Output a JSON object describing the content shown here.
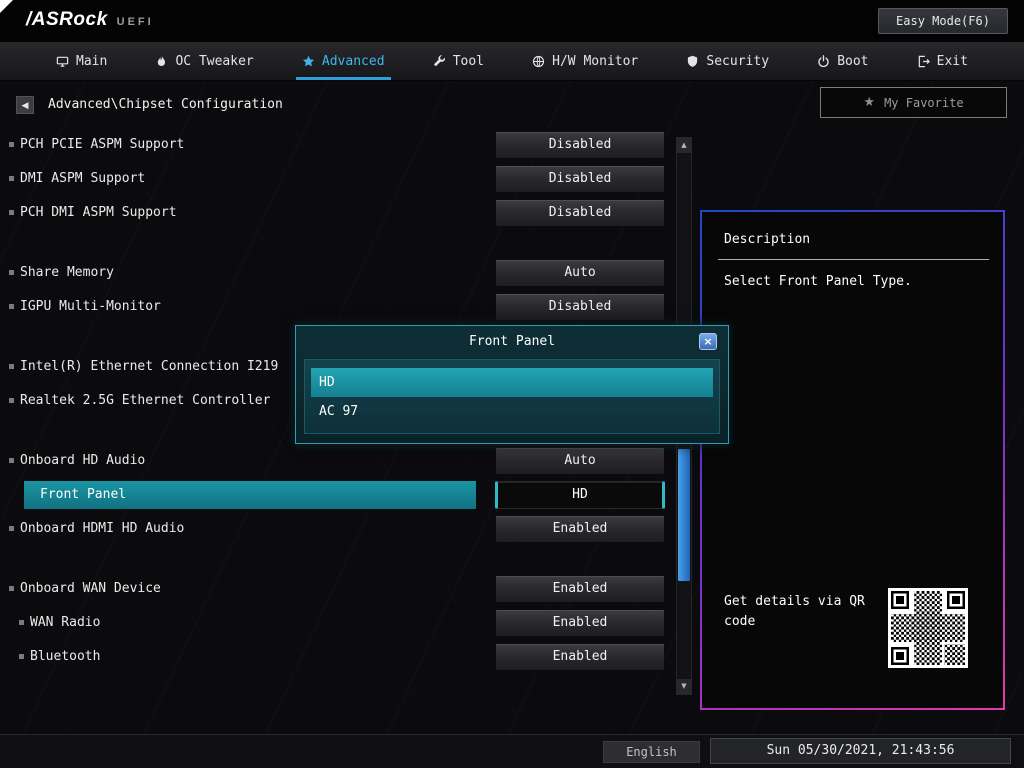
{
  "header": {
    "logo": "/ASRock",
    "logo_sub": "UEFI",
    "easy_mode": "Easy Mode(F6)"
  },
  "nav": {
    "tabs": [
      {
        "label": "Main"
      },
      {
        "label": "OC Tweaker"
      },
      {
        "label": "Advanced",
        "active": true
      },
      {
        "label": "Tool"
      },
      {
        "label": "H/W Monitor"
      },
      {
        "label": "Security"
      },
      {
        "label": "Boot"
      },
      {
        "label": "Exit"
      }
    ]
  },
  "breadcrumb": "Advanced\\Chipset Configuration",
  "my_favorite": "My Favorite",
  "settings": [
    {
      "label": "PCH PCIE ASPM Support",
      "value": "Disabled"
    },
    {
      "label": "DMI ASPM Support",
      "value": "Disabled"
    },
    {
      "label": "PCH DMI ASPM Support",
      "value": "Disabled"
    },
    {
      "label": "Share Memory",
      "value": "Auto"
    },
    {
      "label": "IGPU Multi-Monitor",
      "value": "Disabled"
    },
    {
      "label": "Intel(R) Ethernet Connection I219",
      "value": ""
    },
    {
      "label": "Realtek 2.5G Ethernet Controller",
      "value": ""
    },
    {
      "label": "Onboard HD Audio",
      "value": "Auto"
    },
    {
      "label": "Front Panel",
      "value": "HD",
      "selected": true
    },
    {
      "label": "Onboard HDMI HD Audio",
      "value": "Enabled"
    },
    {
      "label": "Onboard WAN Device",
      "value": "Enabled"
    },
    {
      "label": "WAN Radio",
      "value": "Enabled"
    },
    {
      "label": "Bluetooth",
      "value": "Enabled"
    }
  ],
  "modal": {
    "title": "Front Panel",
    "options": [
      {
        "label": "HD",
        "selected": true
      },
      {
        "label": "AC 97",
        "selected": false
      }
    ]
  },
  "description_panel": {
    "title": "Description",
    "body": "Select Front Panel Type.",
    "qr_caption": "Get details via QR code"
  },
  "footer": {
    "language": "English",
    "datetime": "Sun 05/30/2021, 21:43:56"
  },
  "icons": {
    "back": "◀",
    "star": "★",
    "close": "×",
    "scroll_up": "▲",
    "scroll_down": "▼"
  },
  "colors": {
    "accent_teal": "#1b96a5",
    "accent_blue": "#3aa7e0",
    "accent_magenta": "#e23aa8",
    "scroll_thumb_blue": "#2f86d8"
  }
}
